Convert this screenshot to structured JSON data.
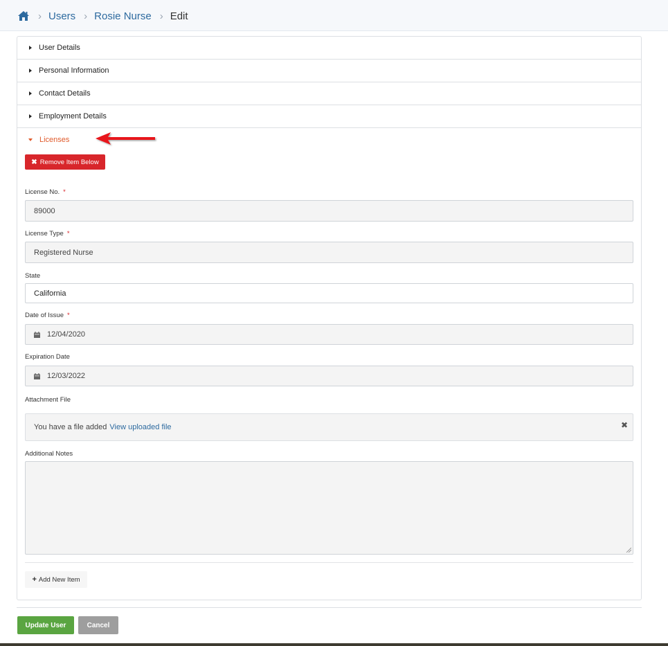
{
  "breadcrumb": {
    "items": [
      "Users",
      "Rosie Nurse"
    ],
    "current": "Edit"
  },
  "accordion": {
    "collapsed": [
      "User Details",
      "Personal Information",
      "Contact Details",
      "Employment Details"
    ],
    "open": "Licenses"
  },
  "licenses": {
    "remove_label": "Remove Item Below",
    "license_no": {
      "label": "License No.",
      "value": "89000",
      "required": true
    },
    "license_type": {
      "label": "License Type",
      "value": "Registered Nurse",
      "required": true
    },
    "state": {
      "label": "State",
      "value": "California"
    },
    "date_of_issue": {
      "label": "Date of Issue",
      "value": "12/04/2020",
      "required": true
    },
    "expiration_date": {
      "label": "Expiration Date",
      "value": "12/03/2022"
    },
    "attachment": {
      "label": "Attachment File",
      "text": "You have a file added",
      "link": "View uploaded file"
    },
    "notes": {
      "label": "Additional Notes",
      "value": ""
    },
    "add_label": "Add New Item"
  },
  "actions": {
    "update_label": "Update User",
    "cancel_label": "Cancel"
  },
  "colors": {
    "accent_orange": "#e05a2b",
    "danger": "#d8262b",
    "success": "#5aa541",
    "link": "#2d6a9f"
  }
}
